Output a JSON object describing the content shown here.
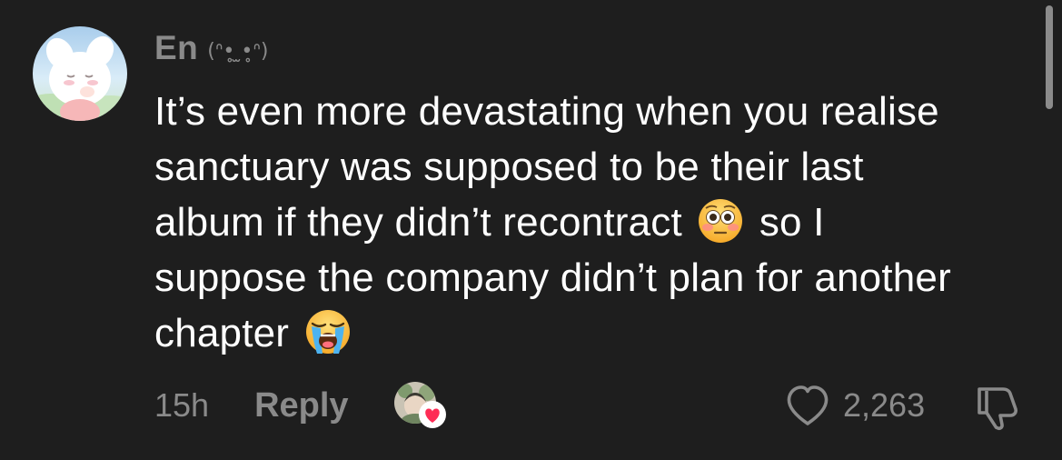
{
  "comment": {
    "username": "En",
    "username_decoration": "(ᐢ•̥ ̫•̥ᐢ)",
    "text_lines": [
      "It’s even more devastating when you realise",
      "sanctuary was supposed to be their last",
      "album if they didn’t recontract",
      "so I",
      "suppose the company didn’t plan for another",
      "chapter"
    ],
    "emojis": {
      "first": "flushed-face",
      "second": "loudly-crying-face"
    },
    "timestamp": "15h",
    "reply_label": "Reply",
    "like_count": "2,263",
    "liked_by_creator": true
  },
  "colors": {
    "background": "#1e1e1e",
    "text": "#ffffff",
    "muted": "#8a8a8a",
    "creator_heart": "#fe2c55"
  },
  "icons": {
    "like": "heart-outline-icon",
    "dislike": "thumbs-down-icon",
    "creator_like": "heart-filled-icon"
  }
}
